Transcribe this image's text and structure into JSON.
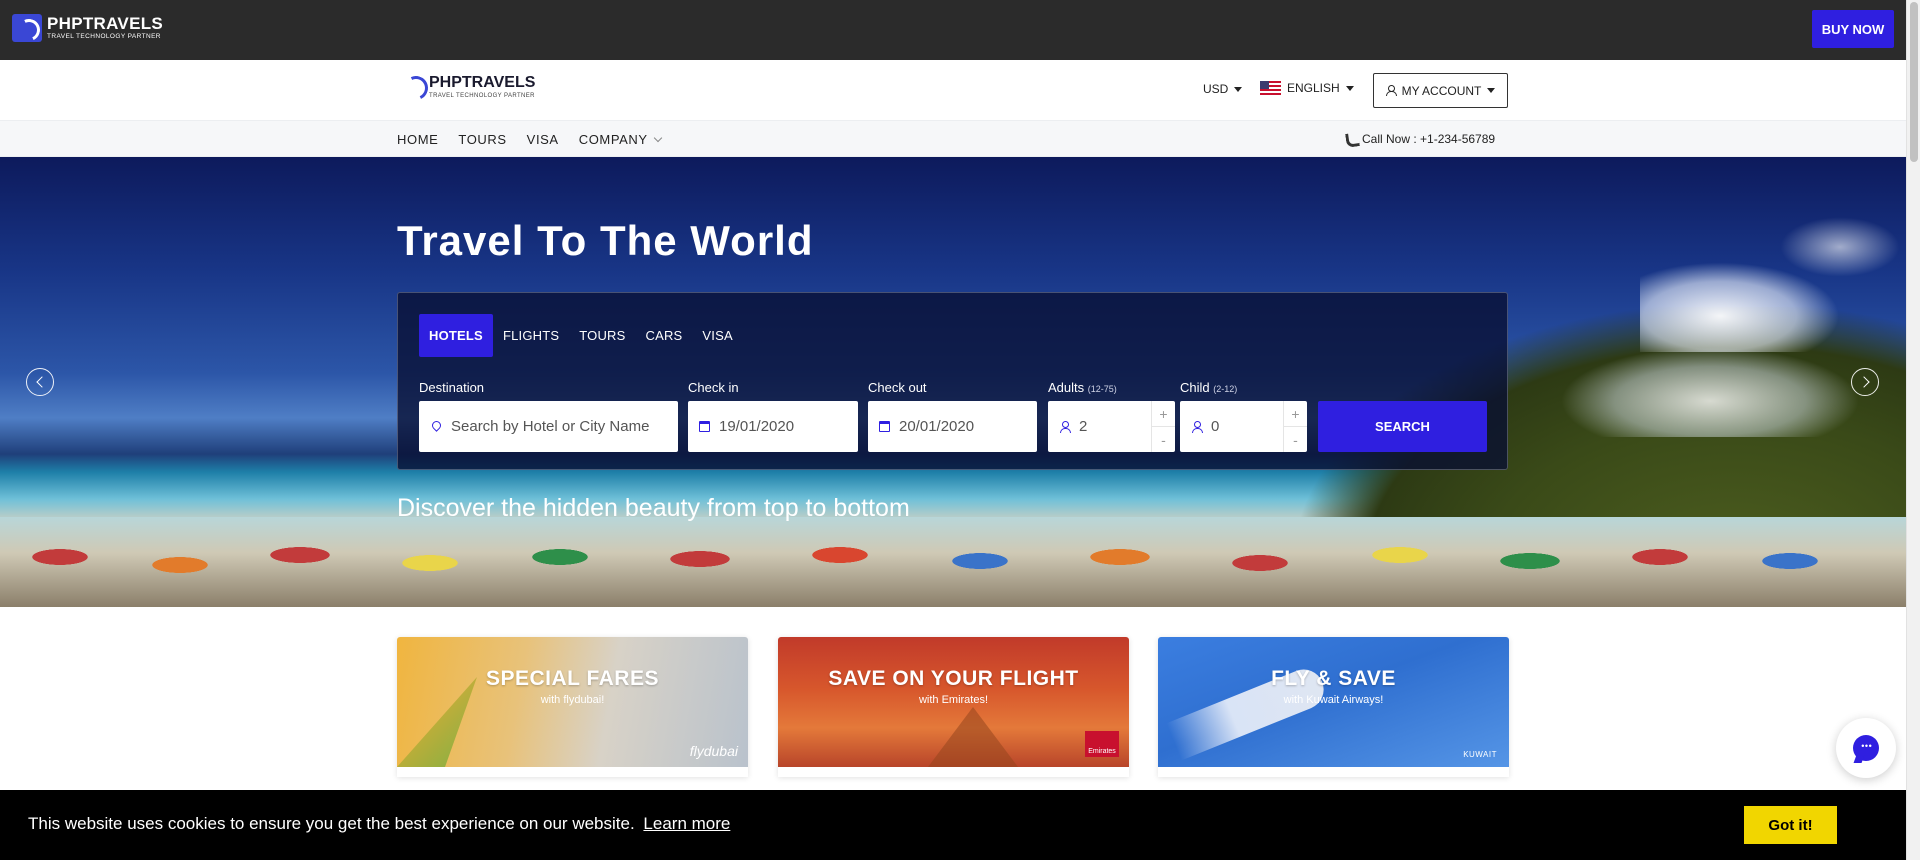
{
  "topbar": {
    "logo_name": "PHPTRAVELS",
    "logo_tagline": "TRAVEL TECHNOLOGY PARTNER",
    "buy_now": "BUY NOW"
  },
  "header": {
    "logo_name": "PHPTRAVELS",
    "logo_tagline": "TRAVEL TECHNOLOGY PARTNER",
    "currency": "USD",
    "language": "ENGLISH",
    "account": "MY ACCOUNT"
  },
  "nav": {
    "items": [
      "HOME",
      "TOURS",
      "VISA",
      "COMPANY"
    ],
    "call_now": "Call Now : +1-234-56789"
  },
  "hero": {
    "title": "Travel To The World",
    "subtitle": "Discover the hidden beauty from top to bottom"
  },
  "search": {
    "tabs": [
      "HOTELS",
      "FLIGHTS",
      "TOURS",
      "CARS",
      "VISA"
    ],
    "active_tab": "HOTELS",
    "destination_label": "Destination",
    "destination_placeholder": "Search by Hotel or City Name",
    "checkin_label": "Check in",
    "checkin_value": "19/01/2020",
    "checkout_label": "Check out",
    "checkout_value": "20/01/2020",
    "adults_label": "Adults",
    "adults_range": "(12-75)",
    "adults_value": "2",
    "child_label": "Child",
    "child_range": "(2-12)",
    "child_value": "0",
    "plus": "+",
    "minus": "-",
    "search_button": "SEARCH"
  },
  "promos": [
    {
      "title": "SPECIAL FARES",
      "subtitle": "with flydubai!",
      "brand": "flydubai"
    },
    {
      "title": "SAVE ON YOUR FLIGHT",
      "subtitle": "with Emirates!",
      "brand": "Emirates"
    },
    {
      "title": "FLY & SAVE",
      "subtitle": "with Kuwait Airways!",
      "brand": "KUWAIT"
    }
  ],
  "cookie": {
    "text": "This website uses cookies to ensure you get the best experience on our website.",
    "learn_more": "Learn more",
    "button": "Got it!"
  },
  "colors": {
    "accent": "#2f1fe0",
    "topbar": "#2b2b2b",
    "cookie_button": "#f1d600"
  },
  "icons": [
    "logo-icon",
    "caret-down-icon",
    "flag-us-icon",
    "user-icon",
    "phone-icon",
    "chevron-left-icon",
    "chevron-right-icon",
    "location-pin-icon",
    "calendar-icon",
    "person-icon",
    "chat-icon"
  ]
}
